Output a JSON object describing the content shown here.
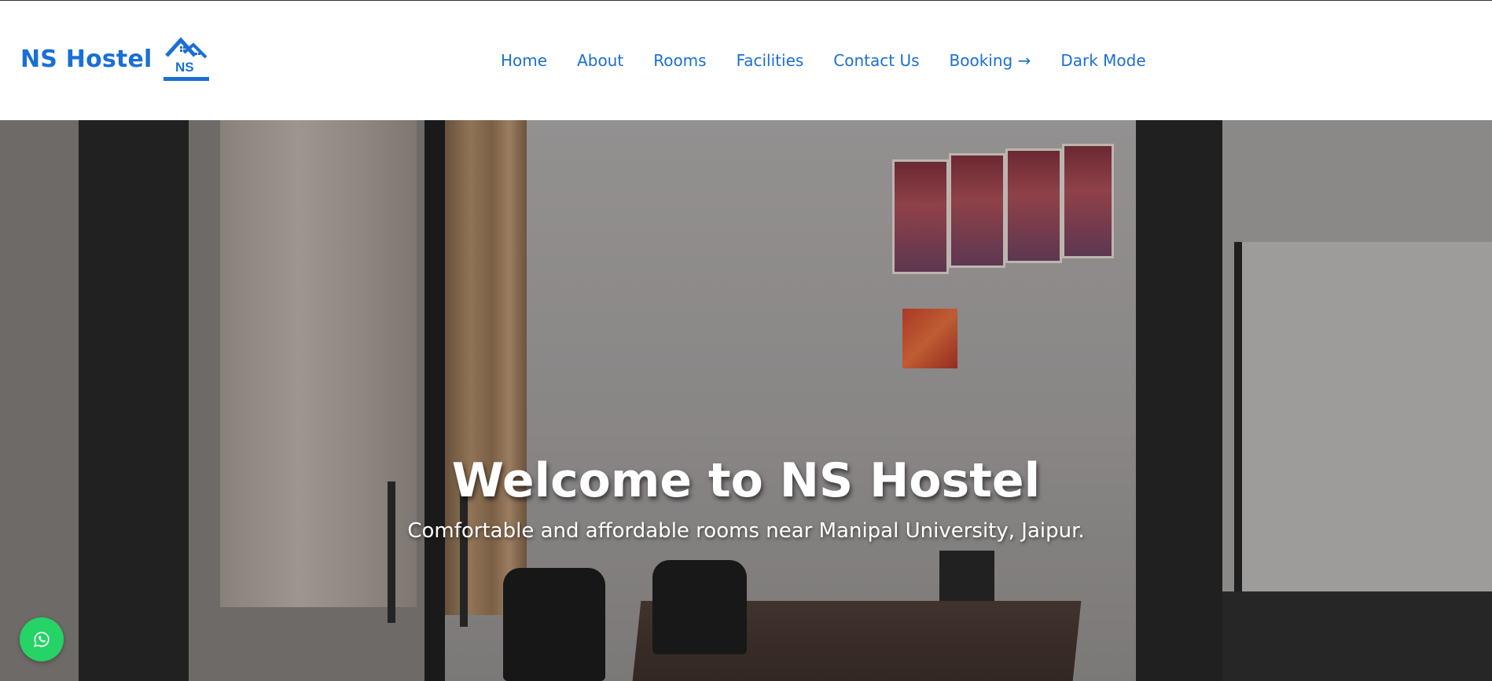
{
  "header": {
    "brand_name": "NS Hostel",
    "logo_text": "NS",
    "nav": [
      {
        "label": "Home"
      },
      {
        "label": "About"
      },
      {
        "label": "Rooms"
      },
      {
        "label": "Facilities"
      },
      {
        "label": "Contact Us"
      },
      {
        "label": "Booking →"
      },
      {
        "label": "Dark Mode"
      }
    ]
  },
  "hero": {
    "title": "Welcome to NS Hostel",
    "subtitle": "Comfortable and affordable rooms near Manipal University, Jaipur."
  },
  "floating": {
    "whatsapp_icon": "whatsapp-icon"
  },
  "colors": {
    "brand": "#1a6fd4",
    "whatsapp": "#25d366"
  }
}
